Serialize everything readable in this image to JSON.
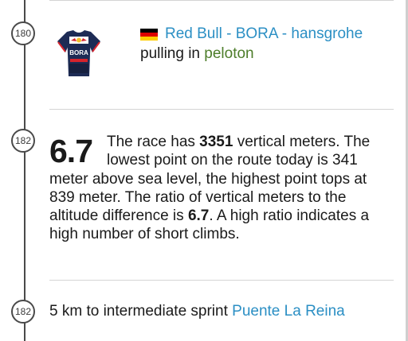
{
  "entries": [
    {
      "km": "180",
      "team_flag": "germany-flag",
      "team_name": "Red Bull - BORA - hansgrohe",
      "action": "pulling in",
      "group": "peloton"
    },
    {
      "km": "182",
      "big_value": "6.7",
      "sentence1_pre": "The race has ",
      "vertical_meters": "3351",
      "sentence1_post": " vertical meters. The lowest point on the route today is 341 meter above sea level, the highest point tops at 839 meter. The ratio of vertical meters to the altitude difference is ",
      "ratio": "6.7",
      "sentence2": ". A high ratio indicates a high number of short climbs."
    },
    {
      "km": "182",
      "sprint_prefix": "5 km to intermediate sprint ",
      "sprint_location": "Puente La Reina"
    }
  ],
  "jersey": {
    "text_top": "Red Bull",
    "text_main": "BORA",
    "text_bottom": "hansgrohe"
  },
  "colors": {
    "link": "#2b8fc4",
    "group": "#4d7d2a",
    "timeline": "#4a4a4a",
    "divider": "#d4d4d4"
  }
}
